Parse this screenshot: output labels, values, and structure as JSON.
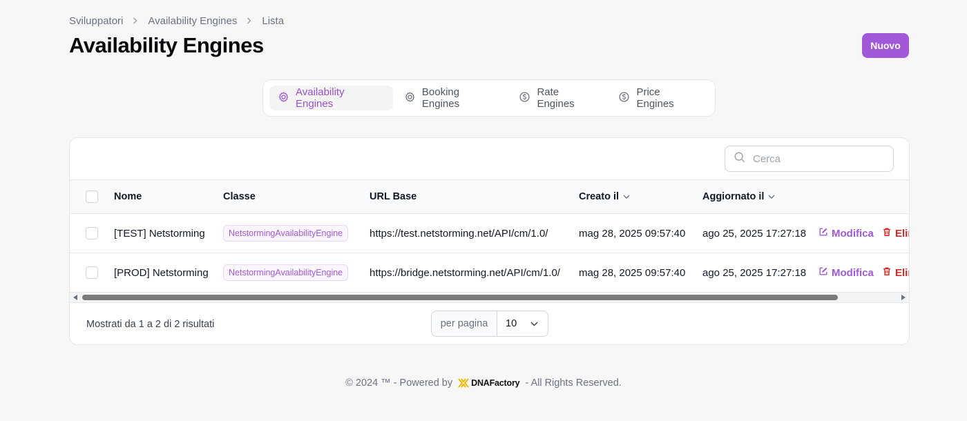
{
  "breadcrumb": [
    "Sviluppatori",
    "Availability Engines",
    "Lista"
  ],
  "page_title": "Availability Engines",
  "new_button": "Nuovo",
  "tabs": [
    {
      "label": "Availability Engines",
      "icon": "cog-icon",
      "active": true
    },
    {
      "label": "Booking Engines",
      "icon": "cog-icon",
      "active": false
    },
    {
      "label": "Rate Engines",
      "icon": "dollar-icon",
      "active": false
    },
    {
      "label": "Price Engines",
      "icon": "dollar-icon",
      "active": false
    }
  ],
  "search": {
    "placeholder": "Cerca"
  },
  "table": {
    "columns": [
      "Nome",
      "Classe",
      "URL Base",
      "Creato il",
      "Aggiornato il"
    ],
    "rows": [
      {
        "nome": "[TEST] Netstorming",
        "classe": "NetstormingAvailabilityEngine",
        "url": "https://test.netstorming.net/API/cm/1.0/",
        "creato": "mag 28, 2025 09:57:40",
        "aggiornato": "ago 25, 2025 17:27:18"
      },
      {
        "nome": "[PROD] Netstorming",
        "classe": "NetstormingAvailabilityEngine",
        "url": "https://bridge.netstorming.net/API/cm/1.0/",
        "creato": "mag 28, 2025 09:57:40",
        "aggiornato": "ago 25, 2025 17:27:18"
      }
    ],
    "actions": {
      "edit": "Modifica",
      "delete": "Elimina"
    }
  },
  "pagination": {
    "results": "Mostrati da 1 a 2 di 2 risultati",
    "per_page_label": "per pagina",
    "per_page_value": "10"
  },
  "footer": {
    "left": "© 2024 ™ - Powered by",
    "brand": "DNAFactory",
    "right": "- All Rights Reserved."
  },
  "colors": {
    "accent": "#a259d9",
    "danger": "#dc2626"
  }
}
